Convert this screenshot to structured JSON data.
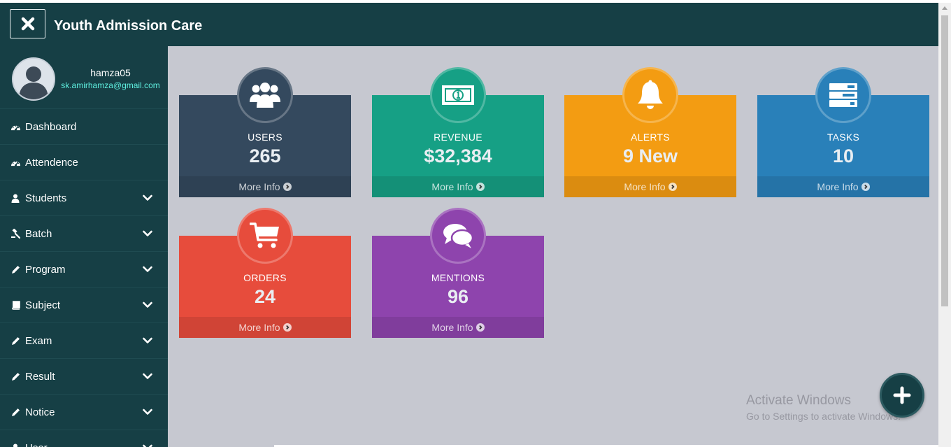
{
  "app": {
    "title": "Youth Admission Care"
  },
  "profile": {
    "username": "hamza05",
    "email": "sk.amirhamza@gmail.com"
  },
  "sidebar": {
    "items": [
      {
        "label": "Dashboard",
        "icon": "dashboard-icon",
        "has_submenu": false
      },
      {
        "label": "Attendence",
        "icon": "dashboard-icon",
        "has_submenu": false
      },
      {
        "label": "Students",
        "icon": "user-icon",
        "has_submenu": true
      },
      {
        "label": "Batch",
        "icon": "gavel-icon",
        "has_submenu": true
      },
      {
        "label": "Program",
        "icon": "pencil-icon",
        "has_submenu": true
      },
      {
        "label": "Subject",
        "icon": "book-icon",
        "has_submenu": true
      },
      {
        "label": "Exam",
        "icon": "pencil-icon",
        "has_submenu": true
      },
      {
        "label": "Result",
        "icon": "pencil-icon",
        "has_submenu": true
      },
      {
        "label": "Notice",
        "icon": "pencil-icon",
        "has_submenu": true
      },
      {
        "label": "User",
        "icon": "user-icon",
        "has_submenu": true
      }
    ]
  },
  "cards": [
    {
      "label": "USERS",
      "value": "265",
      "footer": "More Info",
      "icon": "users-icon",
      "color": "#34495e",
      "footer_color": "#2e4154"
    },
    {
      "label": "REVENUE",
      "value": "$32,384",
      "footer": "More Info",
      "icon": "money-icon",
      "color": "#16a085",
      "footer_color": "#149077"
    },
    {
      "label": "ALERTS",
      "value": "9 New",
      "footer": "More Info",
      "icon": "bell-icon",
      "color": "#f39c12",
      "footer_color": "#db8c10"
    },
    {
      "label": "TASKS",
      "value": "10",
      "footer": "More Info",
      "icon": "tasks-icon",
      "color": "#2980b9",
      "footer_color": "#2573a7"
    },
    {
      "label": "ORDERS",
      "value": "24",
      "footer": "More Info",
      "icon": "cart-icon",
      "color": "#e74c3c",
      "footer_color": "#d04436"
    },
    {
      "label": "MENTIONS",
      "value": "96",
      "footer": "More Info",
      "icon": "comments-icon",
      "color": "#8e44ad",
      "footer_color": "#803d9c"
    }
  ],
  "watermark": {
    "title": "Activate Windows",
    "subtitle": "Go to Settings to activate Windows."
  }
}
